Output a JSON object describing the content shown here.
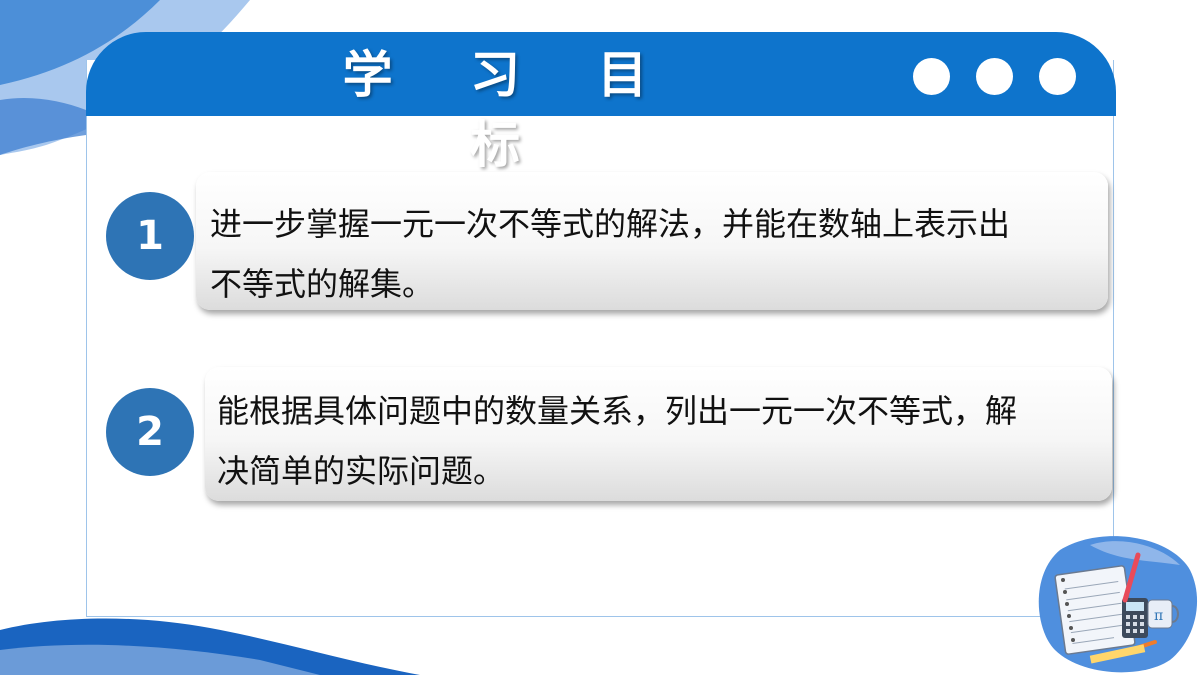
{
  "slide": {
    "title": "学 习 目 标",
    "colors": {
      "header": "#0e74cc",
      "badge": "#2e74b5",
      "frame_border": "#9ec4ea",
      "wave_light": "#7fa9dd"
    },
    "goals": [
      {
        "number": "1",
        "lines": [
          "进一步掌握一元一次不等式的解法，并能在数轴上表示出",
          "不等式的解集。"
        ]
      },
      {
        "number": "2",
        "lines": [
          "能根据具体问题中的数量关系，列出一元一次不等式，解",
          "决简单的实际问题。"
        ]
      }
    ],
    "decorations": {
      "header_dots_icon": "three-white-dots-icon",
      "illustration_icon": "math-stationery-illustration-icon",
      "pi_symbol": "π"
    }
  }
}
